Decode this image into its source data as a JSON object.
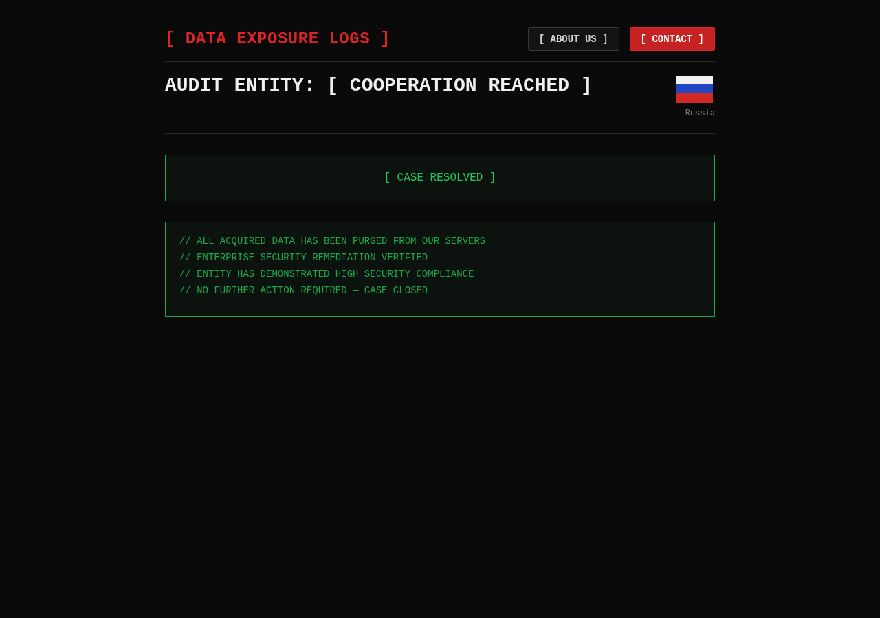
{
  "header": {
    "title": "[ DATA EXPOSURE LOGS ]",
    "nav": [
      {
        "label": "[ ABOUT US ]",
        "kind": "outline"
      },
      {
        "label": "[ CONTACT ]",
        "kind": "primary"
      }
    ]
  },
  "entity": {
    "heading": "AUDIT ENTITY: [ COOPERATION REACHED ]",
    "country": "Russia"
  },
  "status": {
    "label": "[ CASE RESOLVED ]"
  },
  "notes": [
    "// ALL ACQUIRED DATA HAS BEEN PURGED FROM OUR SERVERS",
    "// ENTERPRISE SECURITY REMEDIATION VERIFIED",
    "// ENTITY HAS DEMONSTRATED HIGH SECURITY COMPLIANCE",
    "// NO FURTHER ACTION REQUIRED — CASE CLOSED"
  ]
}
